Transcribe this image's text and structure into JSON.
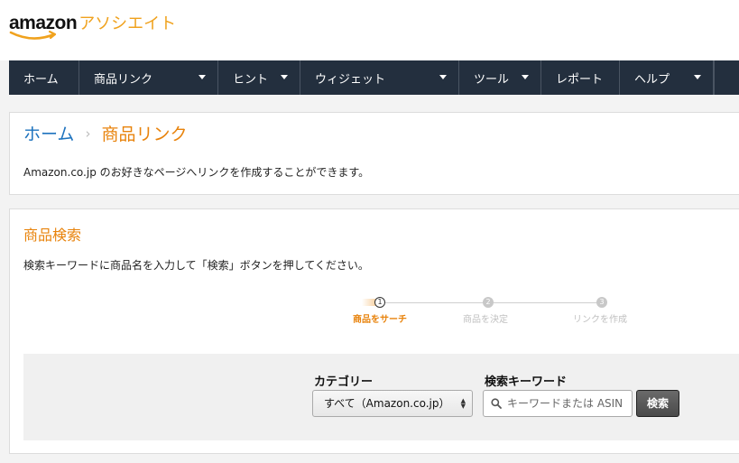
{
  "header": {
    "logo_text": "amazon",
    "logo_subtitle": "アソシエイト"
  },
  "nav": {
    "items": [
      {
        "label": "ホーム",
        "dropdown": false
      },
      {
        "label": "商品リンク",
        "dropdown": true
      },
      {
        "label": "ヒント",
        "dropdown": true
      },
      {
        "label": "ウィジェット",
        "dropdown": true
      },
      {
        "label": "ツール",
        "dropdown": true
      },
      {
        "label": "レポート",
        "dropdown": false
      },
      {
        "label": "ヘルプ",
        "dropdown": true
      }
    ]
  },
  "breadcrumb": {
    "home": "ホーム",
    "separator": "›",
    "current": "商品リンク"
  },
  "intro": {
    "description": "Amazon.co.jp のお好きなページへリンクを作成することができます。"
  },
  "search_section": {
    "title": "商品検索",
    "description": "検索キーワードに商品名を入力して「検索」ボタンを押してください。",
    "steps": [
      {
        "number": "1",
        "label": "商品をサーチ",
        "active": true
      },
      {
        "number": "2",
        "label": "商品を決定",
        "active": false
      },
      {
        "number": "3",
        "label": "リンクを作成",
        "active": false
      }
    ],
    "category_label": "カテゴリー",
    "category_value": "すべて（Amazon.co.jp）",
    "keyword_label": "検索キーワード",
    "keyword_placeholder": "キーワードまたは ASIN",
    "search_button": "検索"
  },
  "colors": {
    "nav_bg": "#232f3e",
    "accent_orange": "#e8830c",
    "link_blue": "#1e73be"
  }
}
